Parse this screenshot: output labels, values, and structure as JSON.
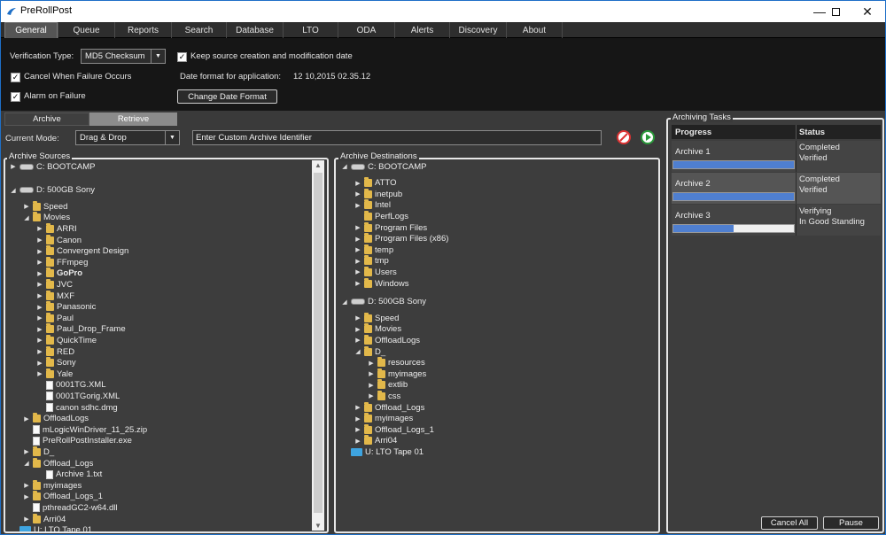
{
  "window": {
    "title": "PreRollPost"
  },
  "tabs": [
    "General",
    "Queue",
    "Reports",
    "Search",
    "Database",
    "LTO",
    "ODA",
    "Alerts",
    "Discovery",
    "About"
  ],
  "general": {
    "verification_label": "Verification Type:",
    "verification_value": "MD5 Checksum",
    "keep_dates_label": "Keep source creation and modification date",
    "cancel_failure_label": "Cancel When Failure Occurs",
    "date_format_label": "Date format for application:",
    "date_format_value": "12 10,2015 02.35.12",
    "alarm_label": "Alarm on Failure",
    "change_date_button": "Change Date Format"
  },
  "subtabs": [
    "Archive",
    "Retrieve"
  ],
  "mode": {
    "label": "Current Mode:",
    "value": "Drag & Drop",
    "identifier_placeholder": "Enter Custom Archive Identifier"
  },
  "sources": {
    "title": "Archive Sources",
    "nodes": [
      {
        "t": "C: BOOTCAMP",
        "icon": "drive",
        "lvl": 0,
        "tw": "▶"
      },
      {
        "t": "D: 500GB Sony",
        "icon": "drive",
        "lvl": 0,
        "tw": "◢"
      },
      {
        "t": "Speed",
        "icon": "folder",
        "lvl": 1,
        "tw": "▶"
      },
      {
        "t": "Movies",
        "icon": "folder",
        "lvl": 1,
        "tw": "◢"
      },
      {
        "t": "ARRI",
        "icon": "folder",
        "lvl": 2,
        "tw": "▶"
      },
      {
        "t": "Canon",
        "icon": "folder",
        "lvl": 2,
        "tw": "▶"
      },
      {
        "t": "Convergent Design",
        "icon": "folder",
        "lvl": 2,
        "tw": "▶"
      },
      {
        "t": "FFmpeg",
        "icon": "folder",
        "lvl": 2,
        "tw": "▶"
      },
      {
        "t": "GoPro",
        "icon": "folder",
        "lvl": 2,
        "tw": "▶",
        "bold": true
      },
      {
        "t": "JVC",
        "icon": "folder",
        "lvl": 2,
        "tw": "▶"
      },
      {
        "t": "MXF",
        "icon": "folder",
        "lvl": 2,
        "tw": "▶"
      },
      {
        "t": "Panasonic",
        "icon": "folder",
        "lvl": 2,
        "tw": "▶"
      },
      {
        "t": "Paul",
        "icon": "folder",
        "lvl": 2,
        "tw": "▶"
      },
      {
        "t": "Paul_Drop_Frame",
        "icon": "folder",
        "lvl": 2,
        "tw": "▶"
      },
      {
        "t": "QuickTime",
        "icon": "folder",
        "lvl": 2,
        "tw": "▶"
      },
      {
        "t": "RED",
        "icon": "folder",
        "lvl": 2,
        "tw": "▶"
      },
      {
        "t": "Sony",
        "icon": "folder",
        "lvl": 2,
        "tw": "▶"
      },
      {
        "t": "Yale",
        "icon": "folder",
        "lvl": 2,
        "tw": "▶"
      },
      {
        "t": "0001TG.XML",
        "icon": "file",
        "lvl": 2,
        "tw": ""
      },
      {
        "t": "0001TGorig.XML",
        "icon": "file",
        "lvl": 2,
        "tw": ""
      },
      {
        "t": "canon sdhc.dmg",
        "icon": "file",
        "lvl": 2,
        "tw": ""
      },
      {
        "t": "OffloadLogs",
        "icon": "folder",
        "lvl": 1,
        "tw": "▶"
      },
      {
        "t": "mLogicWinDriver_11_25.zip",
        "icon": "file",
        "lvl": 1,
        "tw": ""
      },
      {
        "t": "PreRollPostInstaller.exe",
        "icon": "file",
        "lvl": 1,
        "tw": ""
      },
      {
        "t": "D_",
        "icon": "folder",
        "lvl": 1,
        "tw": "▶"
      },
      {
        "t": "Offload_Logs",
        "icon": "folder",
        "lvl": 1,
        "tw": "◢"
      },
      {
        "t": "Archive 1.txt",
        "icon": "file",
        "lvl": 2,
        "tw": ""
      },
      {
        "t": "myimages",
        "icon": "folder",
        "lvl": 1,
        "tw": "▶"
      },
      {
        "t": "Offload_Logs_1",
        "icon": "folder",
        "lvl": 1,
        "tw": "▶"
      },
      {
        "t": "pthreadGC2-w64.dll",
        "icon": "file",
        "lvl": 1,
        "tw": ""
      },
      {
        "t": "Arri04",
        "icon": "folder",
        "lvl": 1,
        "tw": "▶"
      },
      {
        "t": "U: LTO Tape 01",
        "icon": "tape",
        "lvl": 0,
        "tw": ""
      }
    ]
  },
  "destinations": {
    "title": "Archive Destinations",
    "nodes": [
      {
        "t": "C: BOOTCAMP",
        "icon": "drive",
        "lvl": 0,
        "tw": "◢"
      },
      {
        "t": "ATTO",
        "icon": "folder",
        "lvl": 1,
        "tw": "▶"
      },
      {
        "t": "inetpub",
        "icon": "folder",
        "lvl": 1,
        "tw": "▶"
      },
      {
        "t": "Intel",
        "icon": "folder",
        "lvl": 1,
        "tw": "▶"
      },
      {
        "t": "PerfLogs",
        "icon": "folder",
        "lvl": 1,
        "tw": ""
      },
      {
        "t": "Program Files",
        "icon": "folder",
        "lvl": 1,
        "tw": "▶"
      },
      {
        "t": "Program Files (x86)",
        "icon": "folder",
        "lvl": 1,
        "tw": "▶"
      },
      {
        "t": "temp",
        "icon": "folder",
        "lvl": 1,
        "tw": "▶"
      },
      {
        "t": "tmp",
        "icon": "folder",
        "lvl": 1,
        "tw": "▶"
      },
      {
        "t": "Users",
        "icon": "folder",
        "lvl": 1,
        "tw": "▶"
      },
      {
        "t": "Windows",
        "icon": "folder",
        "lvl": 1,
        "tw": "▶"
      },
      {
        "t": "D: 500GB Sony",
        "icon": "drive",
        "lvl": 0,
        "tw": "◢"
      },
      {
        "t": "Speed",
        "icon": "folder",
        "lvl": 1,
        "tw": "▶"
      },
      {
        "t": "Movies",
        "icon": "folder",
        "lvl": 1,
        "tw": "▶"
      },
      {
        "t": "OffloadLogs",
        "icon": "folder",
        "lvl": 1,
        "tw": "▶"
      },
      {
        "t": "D_",
        "icon": "folder",
        "lvl": 1,
        "tw": "◢"
      },
      {
        "t": "resources",
        "icon": "folder",
        "lvl": 2,
        "tw": "▶"
      },
      {
        "t": "myimages",
        "icon": "folder",
        "lvl": 2,
        "tw": "▶"
      },
      {
        "t": "extlib",
        "icon": "folder",
        "lvl": 2,
        "tw": "▶"
      },
      {
        "t": "css",
        "icon": "folder",
        "lvl": 2,
        "tw": "▶"
      },
      {
        "t": "Offload_Logs",
        "icon": "folder",
        "lvl": 1,
        "tw": "▶"
      },
      {
        "t": "myimages",
        "icon": "folder",
        "lvl": 1,
        "tw": "▶"
      },
      {
        "t": "Offload_Logs_1",
        "icon": "folder",
        "lvl": 1,
        "tw": "▶"
      },
      {
        "t": "Arri04",
        "icon": "folder",
        "lvl": 1,
        "tw": "▶"
      },
      {
        "t": "U: LTO Tape 01",
        "icon": "tape",
        "lvl": 0,
        "tw": ""
      }
    ]
  },
  "tasks": {
    "title": "Archiving Tasks",
    "col_progress": "Progress",
    "col_status": "Status",
    "rows": [
      {
        "name": "Archive 1",
        "status1": "Completed",
        "status2": "Verified",
        "progress": 1.0
      },
      {
        "name": "Archive 2",
        "status1": "Completed",
        "status2": "Verified",
        "progress": 1.0
      },
      {
        "name": "Archive 3",
        "status1": "Verifying",
        "status2": "In Good Standing",
        "progress": 0.5
      }
    ],
    "cancel_all": "Cancel All",
    "pause": "Pause"
  },
  "colors": {
    "accent": "#1e6fc7",
    "progress_fill": "#4f7fd0",
    "folder": "#e2b84a",
    "tape": "#3ea4e0"
  }
}
